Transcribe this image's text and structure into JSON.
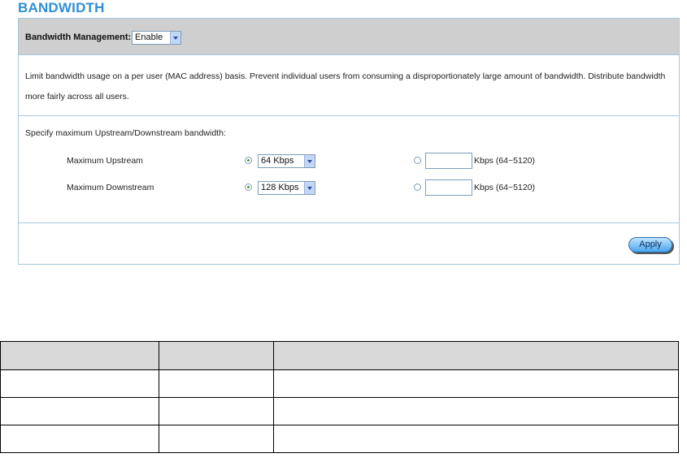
{
  "page": {
    "title": "BANDWIDTH"
  },
  "bandwidth_management": {
    "label": "Bandwidth Management:",
    "value": "Enable"
  },
  "description": "Limit bandwidth usage on a per user (MAC address) basis. Prevent individual users from consuming a disproportionately large amount of bandwidth. Distribute bandwidth more fairly across all users.",
  "spec": {
    "label": "Specify maximum Upstream/Downstream bandwidth:",
    "rows": [
      {
        "label": "Maximum Upstream",
        "preset": "64 Kbps",
        "custom_value": "",
        "range_hint": "Kbps (64~5120)",
        "mode": "preset"
      },
      {
        "label": "Maximum Downstream",
        "preset": "128 Kbps",
        "custom_value": "",
        "range_hint": "Kbps (64~5120)",
        "mode": "preset"
      }
    ]
  },
  "apply_label": "Apply",
  "colors": {
    "title": "#2f8fd6",
    "header_bg": "#cfcfcf",
    "border": "#a8c8dc",
    "radio_checked": "#3aa33a"
  }
}
